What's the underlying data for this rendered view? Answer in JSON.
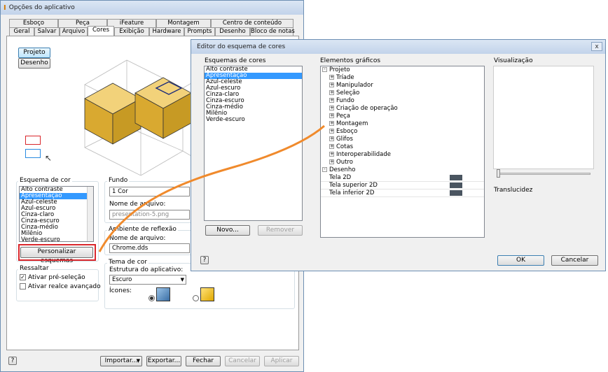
{
  "left": {
    "title": "Opções do aplicativo",
    "tabs_row1": [
      "Esboço",
      "Peça",
      "iFeature",
      "Montagem",
      "Centro de conteúdo"
    ],
    "tabs_row2": [
      "Geral",
      "Salvar",
      "Arquivo",
      "Cores",
      "Exibição",
      "Hardware",
      "Prompts",
      "Desenho",
      "Bloco de notas"
    ],
    "active_tab": "Cores",
    "btn_projeto": "Projeto",
    "btn_desenho": "Desenho",
    "color_scheme_label": "Esquema de cor",
    "schemes": [
      "Alto contraste",
      "Apresentação",
      "Azul-celeste",
      "Azul-escuro",
      "Cinza-claro",
      "Cinza-escuro",
      "Cinza-médio",
      "Milênio",
      "Verde-escuro"
    ],
    "selected_scheme": "Apresentação",
    "customize_btn": "Personalizar esquemas",
    "highlight_label": "Ressaltar",
    "preselect_label": "Ativar pré-seleção",
    "advanced_label": "Ativar realce avançado",
    "background_label": "Fundo",
    "background_value": "1 Cor",
    "filename_label": "Nome de arquivo:",
    "filename_value": "presentation-5.png",
    "reflection_label": "Ambiente de reflexão",
    "reflection_filename_label": "Nome de arquivo:",
    "reflection_filename_value": "Chrome.dds",
    "theme_label": "Tema de cor",
    "app_frame_label": "Estrutura do aplicativo:",
    "app_frame_value": "Escuro",
    "icons_label": "Ícones:",
    "import_btn": "Importar...",
    "export_btn": "Exportar...",
    "close_btn": "Fechar",
    "cancel_btn": "Cancelar",
    "apply_btn": "Aplicar",
    "help_icon": "?"
  },
  "right": {
    "title": "Editor do esquema de cores",
    "schemes_label": "Esquemas de cores",
    "schemes": [
      "Alto contraste",
      "Apresentação",
      "Azul-celeste",
      "Azul-escuro",
      "Cinza-claro",
      "Cinza-escuro",
      "Cinza-médio",
      "Milênio",
      "Verde-escuro"
    ],
    "selected_scheme": "Apresentação",
    "graphics_label": "Elementos gráficos",
    "tree_root": "Projeto",
    "tree_items": [
      "Tríade",
      "Manipulador",
      "Seleção",
      "Fundo",
      "Criação de operação",
      "Peça",
      "Montagem",
      "Esboço",
      "Glifos",
      "Cotas",
      "Interoperabilidade",
      "Outro"
    ],
    "tree_root2": "Desenho",
    "drawing_items": [
      "Tela 2D",
      "Tela superior 2D",
      "Tela inferior 2D"
    ],
    "preview_label": "Visualização",
    "translucency_label": "Translucidez",
    "new_btn": "Novo...",
    "remove_btn": "Remover",
    "ok_btn": "OK",
    "cancel_btn": "Cancelar",
    "help_icon": "?",
    "close_icon": "x"
  },
  "colors": {
    "accent_orange": "#f08a2c",
    "highlight_red": "#d9262b",
    "selection_blue": "#3399ff",
    "cube_gold": "#e8be4e",
    "swatch": "#4a5560"
  }
}
